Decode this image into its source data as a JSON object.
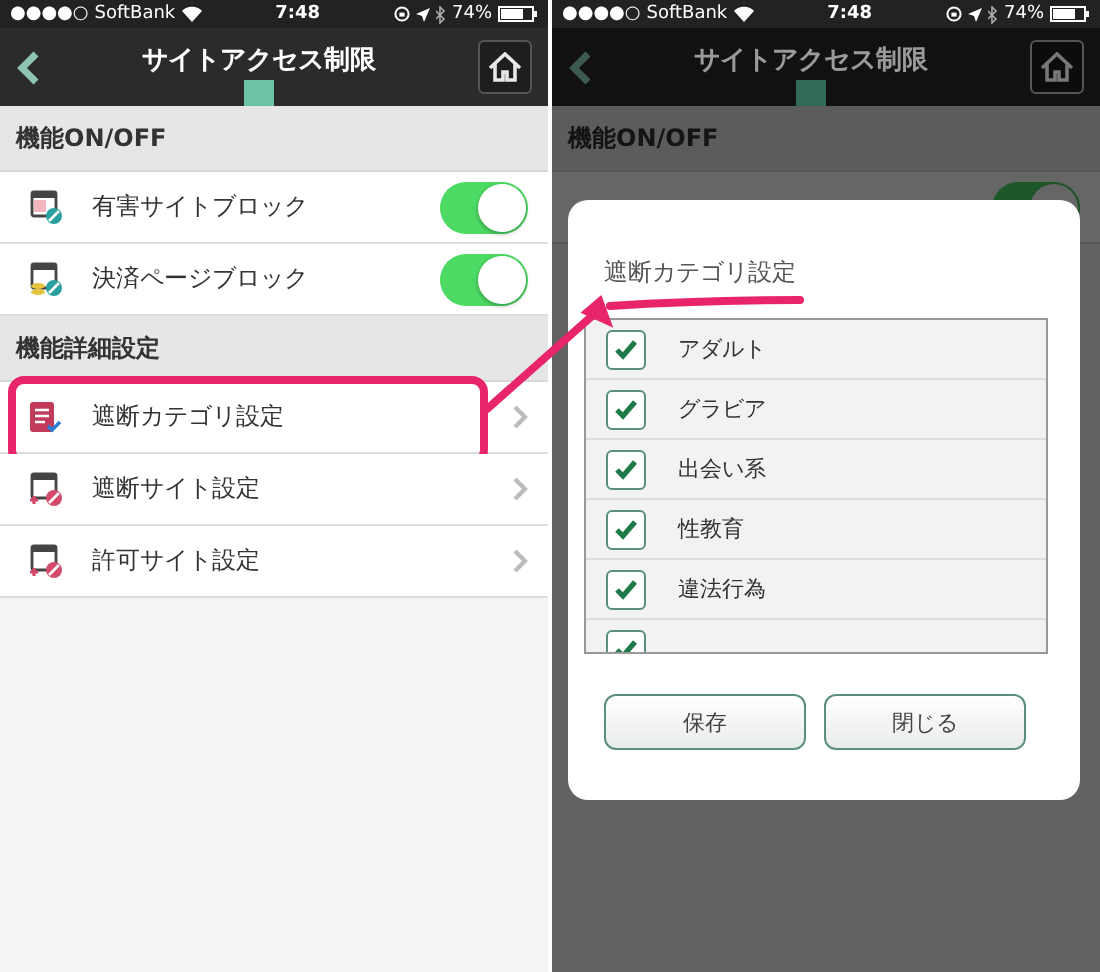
{
  "screens": [
    {
      "status_bar": {
        "signal": "●●●●○",
        "carrier": "SoftBank",
        "time": "7:48",
        "battery": "74%"
      },
      "title": "サイトアクセス制限",
      "dimmed": false,
      "sections": [
        {
          "header": "機能ON/OFF",
          "rows": [
            {
              "kind": "toggle",
              "label": "有害サイトブロック",
              "on": true
            },
            {
              "kind": "toggle",
              "label": "決済ページブロック",
              "on": true
            }
          ]
        },
        {
          "header": "機能詳細設定",
          "rows": [
            {
              "kind": "link",
              "label": "遮断カテゴリ設定",
              "highlighted": true
            },
            {
              "kind": "link",
              "label": "遮断サイト設定",
              "highlighted": false
            },
            {
              "kind": "link",
              "label": "許可サイト設定",
              "highlighted": false
            }
          ]
        }
      ]
    },
    {
      "status_bar": {
        "signal": "●●●●○",
        "carrier": "SoftBank",
        "time": "7:48",
        "battery": "74%"
      },
      "title": "サイトアクセス制限",
      "dimmed": true,
      "sections": [
        {
          "header": "機能ON/OFF",
          "rows": [
            {
              "kind": "toggle",
              "on": true
            }
          ]
        }
      ],
      "dialog": {
        "title": "遮断カテゴリ設定",
        "items": [
          {
            "label": "アダルト",
            "checked": true
          },
          {
            "label": "グラビア",
            "checked": true
          },
          {
            "label": "出会い系",
            "checked": true
          },
          {
            "label": "性教育",
            "checked": true
          },
          {
            "label": "違法行為",
            "checked": true
          },
          {
            "checked": true
          }
        ],
        "buttons": [
          "保存",
          "閉じる"
        ]
      }
    }
  ]
}
